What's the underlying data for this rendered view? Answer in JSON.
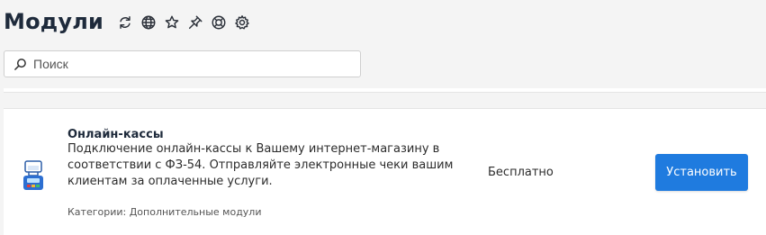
{
  "header": {
    "title": "Модули",
    "icons": [
      "refresh-icon",
      "globe-icon",
      "star-icon",
      "pin-icon",
      "help-circle-icon",
      "gear-icon"
    ]
  },
  "search": {
    "placeholder": "Поиск",
    "value": ""
  },
  "module": {
    "title": "Онлайн-кассы",
    "description": "Подключение онлайн-кассы к Вашему интернет-магазину в соответствии с ФЗ-54. Отправляйте электронные чеки вашим клиентам за оплаченные услуги.",
    "category": "Категории: Дополнительные модули",
    "price": "Бесплатно",
    "install_label": "Установить",
    "icon": "cash-register-icon"
  },
  "colors": {
    "accent": "#1f7bdf",
    "title": "#1e2a3b",
    "background": "#f4f4f4"
  }
}
